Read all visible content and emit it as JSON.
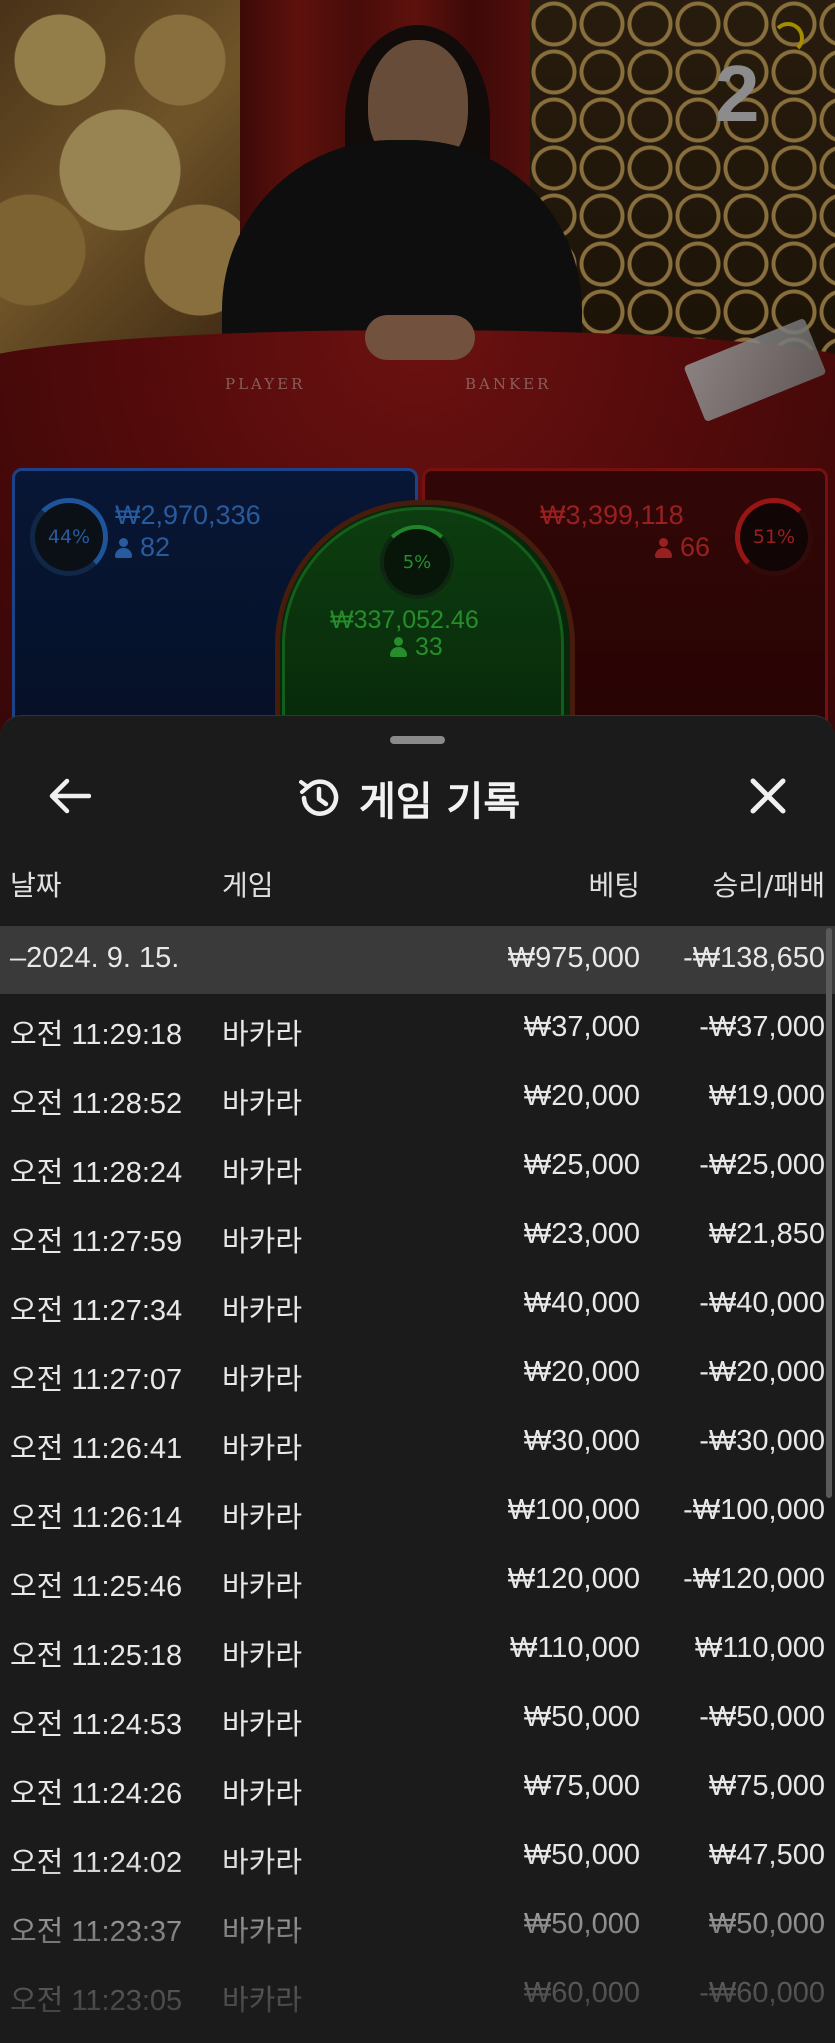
{
  "video": {
    "round_number": "2",
    "table_labels": {
      "player": "PLAYER",
      "banker": "BANKER"
    }
  },
  "bets": {
    "player": {
      "percent": "44%",
      "amount": "₩2,970,336",
      "players": "82"
    },
    "tie": {
      "percent": "5%",
      "amount": "₩337,052.46",
      "players": "33"
    },
    "banker": {
      "percent": "51%",
      "amount": "₩3,399,118",
      "players": "66"
    }
  },
  "colors": {
    "player": "#3a86e8",
    "banker": "#e23030",
    "tie": "#38d040",
    "sheet_bg": "#1b1b1b",
    "summary_bg": "#3a3a3a"
  },
  "history": {
    "title": "게임 기록",
    "icons": {
      "back": "arrow-left-icon",
      "title": "history-icon",
      "close": "close-icon"
    },
    "columns": {
      "date": "날짜",
      "game": "게임",
      "bet": "베팅",
      "result": "승리/패배"
    },
    "summary": {
      "date": "–2024. 9. 15.",
      "bet": "₩975,000",
      "result": "-₩138,650"
    },
    "rows": [
      {
        "time": "오전 11:29:18",
        "game": "바카라",
        "bet": "₩37,000",
        "result": "-₩37,000"
      },
      {
        "time": "오전 11:28:52",
        "game": "바카라",
        "bet": "₩20,000",
        "result": "₩19,000"
      },
      {
        "time": "오전 11:28:24",
        "game": "바카라",
        "bet": "₩25,000",
        "result": "-₩25,000"
      },
      {
        "time": "오전 11:27:59",
        "game": "바카라",
        "bet": "₩23,000",
        "result": "₩21,850"
      },
      {
        "time": "오전 11:27:34",
        "game": "바카라",
        "bet": "₩40,000",
        "result": "-₩40,000"
      },
      {
        "time": "오전 11:27:07",
        "game": "바카라",
        "bet": "₩20,000",
        "result": "-₩20,000"
      },
      {
        "time": "오전 11:26:41",
        "game": "바카라",
        "bet": "₩30,000",
        "result": "-₩30,000"
      },
      {
        "time": "오전 11:26:14",
        "game": "바카라",
        "bet": "₩100,000",
        "result": "-₩100,000"
      },
      {
        "time": "오전 11:25:46",
        "game": "바카라",
        "bet": "₩120,000",
        "result": "-₩120,000"
      },
      {
        "time": "오전 11:25:18",
        "game": "바카라",
        "bet": "₩110,000",
        "result": "₩110,000"
      },
      {
        "time": "오전 11:24:53",
        "game": "바카라",
        "bet": "₩50,000",
        "result": "-₩50,000"
      },
      {
        "time": "오전 11:24:26",
        "game": "바카라",
        "bet": "₩75,000",
        "result": "₩75,000"
      },
      {
        "time": "오전 11:24:02",
        "game": "바카라",
        "bet": "₩50,000",
        "result": "₩47,500"
      },
      {
        "time": "오전 11:23:37",
        "game": "바카라",
        "bet": "₩50,000",
        "result": "₩50,000"
      },
      {
        "time": "오전 11:23:05",
        "game": "바카라",
        "bet": "₩60,000",
        "result": "-₩60,000"
      }
    ]
  }
}
